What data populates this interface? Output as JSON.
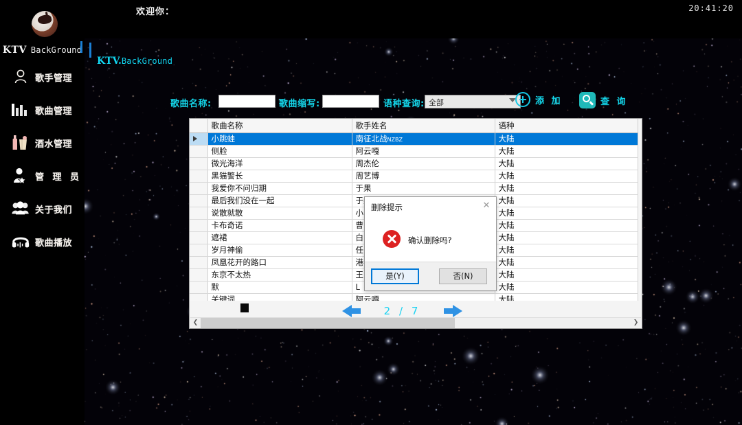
{
  "app": {
    "welcome": "欢迎你：",
    "clock": "20:41:20",
    "brand_ktv": "KTV",
    "brand_suffix": "BackGround"
  },
  "sidebar": {
    "items": [
      {
        "label": "歌手管理",
        "icon": "user-icon"
      },
      {
        "label": "歌曲管理",
        "icon": "bar-chart-icon"
      },
      {
        "label": "酒水管理",
        "icon": "bottle-icon"
      },
      {
        "label": "管 理 员",
        "icon": "admin-star-icon"
      },
      {
        "label": "关于我们",
        "icon": "people-icon"
      },
      {
        "label": "歌曲播放",
        "icon": "headphones-icon"
      }
    ]
  },
  "panel": {
    "title_main": "KTV.",
    "title_sub": "BackGround"
  },
  "search": {
    "name_label": "歌曲名称:",
    "name_value": "",
    "abbr_label": "歌曲缩写:",
    "abbr_value": "",
    "lang_label": "语种查询:",
    "lang_selected": "全部",
    "lang_options": [
      "全部"
    ],
    "add_label": "添 加",
    "query_label": "查 询"
  },
  "table": {
    "headers": [
      "",
      "歌曲名称",
      "歌手姓名",
      "语种"
    ],
    "rows": [
      {
        "name": "小跳蛙",
        "singer": "南征北战",
        "singer_suffix": "NZBZ",
        "lang": "大陆",
        "selected": true
      },
      {
        "name": "侧脸",
        "singer": "阿云嘎",
        "lang": "大陆",
        "selected": false
      },
      {
        "name": "微光海洋",
        "singer": "周杰伦",
        "lang": "大陆",
        "selected": false
      },
      {
        "name": "黑猫警长",
        "singer": "周艺博",
        "lang": "大陆",
        "selected": false
      },
      {
        "name": "我爱你不问归期",
        "singer": "于果",
        "lang": "大陆",
        "selected": false
      },
      {
        "name": "最后我们没在一起",
        "singer": "于果",
        "lang": "大陆",
        "selected": false
      },
      {
        "name": "说散就散",
        "singer": "小",
        "lang": "大陆",
        "selected": false
      },
      {
        "name": "卡布奇诺",
        "singer": "曹",
        "lang": "大陆",
        "selected": false
      },
      {
        "name": "遮裙",
        "singer": "白",
        "lang": "大陆",
        "selected": false
      },
      {
        "name": "岁月神偷",
        "singer": "任",
        "lang": "大陆",
        "selected": false
      },
      {
        "name": "凤凰花开的路口",
        "singer": "港",
        "lang": "大陆",
        "selected": false
      },
      {
        "name": "东京不太热",
        "singer": "王",
        "lang": "大陆",
        "selected": false
      },
      {
        "name": "默",
        "singer": "L",
        "lang": "大陆",
        "selected": false
      },
      {
        "name": "关键词",
        "singer": "阿云嘎",
        "lang": "大陆",
        "selected": false
      }
    ]
  },
  "pager": {
    "current": "2",
    "separator": "/",
    "total": "7"
  },
  "dialog": {
    "title": "删除提示",
    "close": "✕",
    "message": "确认删除吗?",
    "yes_label": "是(Y)",
    "no_label": "否(N)"
  },
  "colors": {
    "accent_cyan": "#13d6ea",
    "selection_blue": "#0078d7",
    "arrow_blue": "#2f92e4",
    "error_red": "#dd2222",
    "background": "#000000"
  }
}
